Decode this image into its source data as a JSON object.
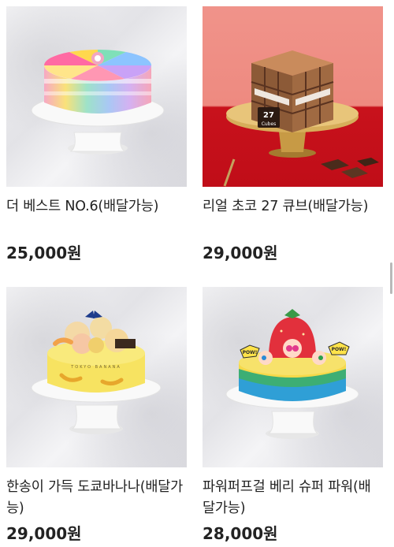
{
  "products": [
    {
      "name": "더 베스트 NO.6(배달가능)",
      "price": "25,000원",
      "image_icon": "rainbow-cake-image"
    },
    {
      "name": "리얼 초코 27 큐브(배달가능)",
      "price": "29,000원",
      "image_icon": "choco-cube-cake-image",
      "cake_label_num": "27",
      "cake_label_text": "Cubes"
    },
    {
      "name": "한송이 가득 도쿄바나나(배달가능)",
      "price": "29,000원",
      "image_icon": "banana-cake-image",
      "cake_label_text": "TOKYO BANANA"
    },
    {
      "name": "파워퍼프걸 베리 슈퍼 파워(배달가능)",
      "price": "28,000원",
      "image_icon": "powerpuff-cake-image",
      "cake_badge_text": "POW!"
    }
  ]
}
